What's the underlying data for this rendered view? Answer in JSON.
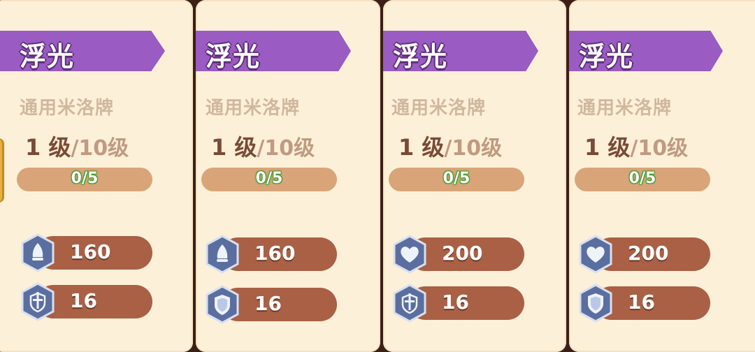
{
  "cards": [
    {
      "title": "浮光",
      "subtitle": "通用米洛牌",
      "level_current": "1 级",
      "level_sep": "/",
      "level_max": "10级",
      "progress": "0/5",
      "stats": [
        {
          "icon": "attack-icon",
          "value": "160"
        },
        {
          "icon": "sword-shield-icon",
          "value": "16"
        }
      ]
    },
    {
      "title": "浮光",
      "subtitle": "通用米洛牌",
      "level_current": "1 级",
      "level_sep": "/",
      "level_max": "10级",
      "progress": "0/5",
      "stats": [
        {
          "icon": "attack-icon",
          "value": "160"
        },
        {
          "icon": "shield-icon",
          "value": "16"
        }
      ]
    },
    {
      "title": "浮光",
      "subtitle": "通用米洛牌",
      "level_current": "1 级",
      "level_sep": "/",
      "level_max": "10级",
      "progress": "0/5",
      "stats": [
        {
          "icon": "heart-icon",
          "value": "200"
        },
        {
          "icon": "sword-shield-icon",
          "value": "16"
        }
      ]
    },
    {
      "title": "浮光",
      "subtitle": "通用米洛牌",
      "level_current": "1 级",
      "level_sep": "/",
      "level_max": "10级",
      "progress": "0/5",
      "stats": [
        {
          "icon": "heart-icon",
          "value": "200"
        },
        {
          "icon": "shield-icon",
          "value": "16"
        }
      ]
    }
  ],
  "colors": {
    "card_bg": "#fdf0d8",
    "banner": "#9a5bc2",
    "progress_bg": "#d9a578",
    "stat_pill": "#a96045",
    "icon_fill": "#5a6fa0",
    "progress_text_outline": "#3e9a2c"
  }
}
